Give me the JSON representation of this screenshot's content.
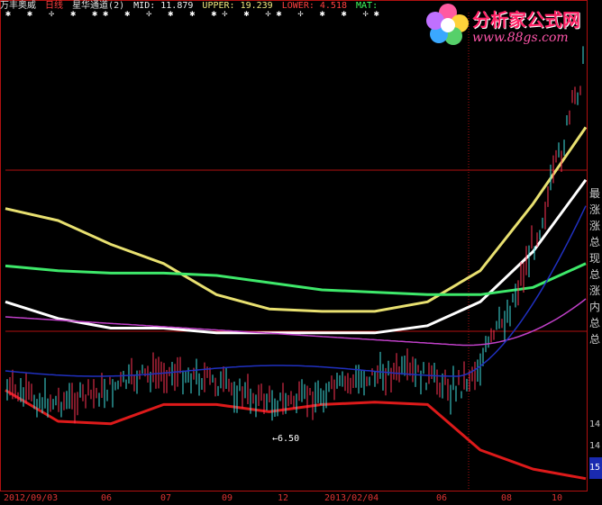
{
  "header": {
    "stock_name": "万丰奥威",
    "period": "日线",
    "indicator": "星华通道(2)",
    "mid": "MID: 11.879",
    "upper": "UPPER: 19.239",
    "lower": "LOWER: 4.518",
    "ma": "MAT:"
  },
  "logo": {
    "title": "分析家公式网",
    "url": "www.88gs.com"
  },
  "right_panel": [
    "最",
    "涨",
    "涨",
    "总",
    "现",
    "总",
    "涨",
    "内",
    "总",
    "总"
  ],
  "price_tags": [
    "14",
    "14",
    "15"
  ],
  "annotation": "←6.50",
  "colors": {
    "upper": "#e8e070",
    "lower": "#dd1a1a",
    "mid": "#ffffff",
    "green": "#3ee86a",
    "magenta": "#c040c8",
    "blue": "#2030c0",
    "yellow2": "#ffff80",
    "up_candle": "#ff3355",
    "down_candle": "#40e0e0",
    "axis": "#b01010"
  },
  "chart_data": {
    "type": "line",
    "x": [
      "2012/09/03",
      "06",
      "07",
      "09",
      "12",
      "2013/02/04",
      "06",
      "08",
      "10"
    ],
    "series": [
      {
        "name": "UPPER",
        "values": [
          15.8,
          15.3,
          14.3,
          13.5,
          12.2,
          11.6,
          11.5,
          11.5,
          11.9,
          13.2,
          16.0,
          19.2
        ]
      },
      {
        "name": "MID",
        "values": [
          11.9,
          11.2,
          10.8,
          10.8,
          10.6,
          10.6,
          10.6,
          10.6,
          10.9,
          11.9,
          14.0,
          17.0
        ]
      },
      {
        "name": "LOWER",
        "values": [
          8.2,
          6.9,
          6.8,
          7.6,
          7.6,
          7.3,
          7.6,
          7.7,
          7.6,
          5.7,
          4.9,
          4.5
        ]
      },
      {
        "name": "MAT",
        "values": [
          13.4,
          13.2,
          13.1,
          13.1,
          13.0,
          12.7,
          12.4,
          12.3,
          12.2,
          12.2,
          12.5,
          13.5
        ]
      }
    ],
    "ylim": [
      4,
      24
    ]
  }
}
